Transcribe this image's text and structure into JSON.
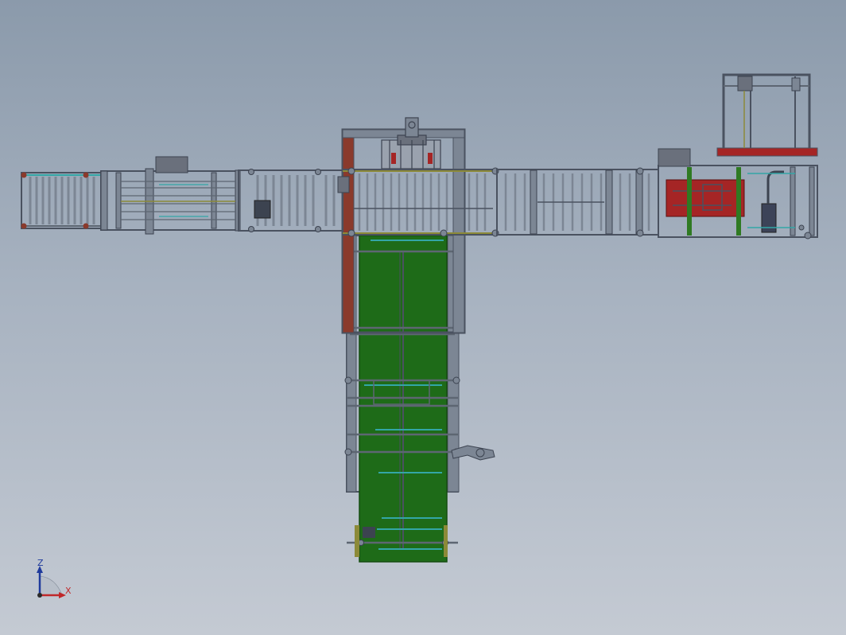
{
  "triad": {
    "z_label": "Z",
    "x_label": "X",
    "colors": {
      "z": "#1f3a9c",
      "x": "#c0282a",
      "origin": "#2a2a2a"
    }
  },
  "palette": {
    "frame": "#4a5260",
    "rail": "#5d6672",
    "roller": "#7c8694",
    "roller_fill": "#b7bec8",
    "belt_green": "#1e6b18",
    "belt_green_dark": "#154d11",
    "cyan": "#33a6a6",
    "red": "#a52525",
    "brown": "#8a3a2c",
    "olive": "#8c8a38",
    "motor": "#3c4350",
    "hopper": "#6a707c"
  },
  "assemblies": [
    {
      "id": "left-infeed-conveyor",
      "type": "roller-conveyor"
    },
    {
      "id": "left-transfer-module",
      "type": "roller-conveyor"
    },
    {
      "id": "central-lifter-tower",
      "type": "tower"
    },
    {
      "id": "right-roller-conveyor",
      "type": "roller-conveyor"
    },
    {
      "id": "right-machine-station",
      "type": "machine"
    },
    {
      "id": "right-top-frame-tower",
      "type": "tower"
    },
    {
      "id": "green-belt-conveyor",
      "type": "belt-conveyor"
    }
  ]
}
